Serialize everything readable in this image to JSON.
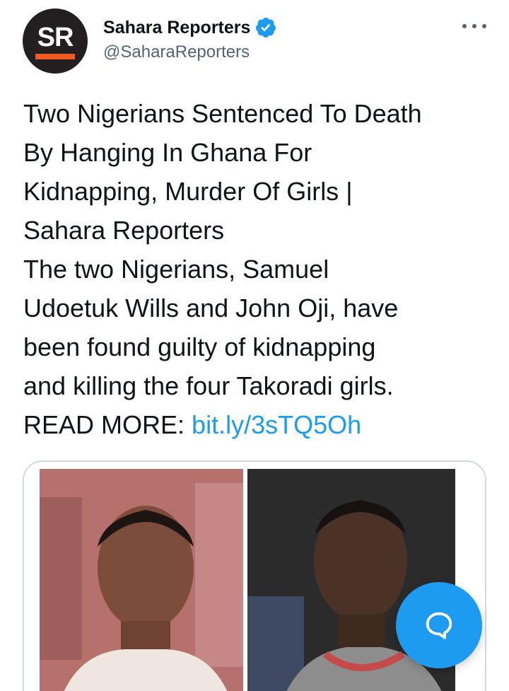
{
  "tweet": {
    "author": {
      "avatar_text": "SR",
      "display_name": "Sahara Reporters",
      "handle": "@SaharaReporters",
      "verified": true
    },
    "body_lines": [
      "Two Nigerians Sentenced To Death",
      "By Hanging In Ghana For",
      "Kidnapping, Murder Of Girls |",
      "Sahara Reporters",
      "The two Nigerians, Samuel",
      "Udoetuk Wills and John Oji, have",
      "been found guilty of kidnapping",
      "and killing the four Takoradi girls."
    ],
    "read_more_label": "READ MORE:",
    "link_text": "bit.ly/3sTQ5Oh"
  },
  "icons": {
    "verified": "verified-badge-icon",
    "more": "more-horizontal-icon",
    "compose": "compose-reply-icon"
  },
  "colors": {
    "accent": "#1d9bf0",
    "brand_bar": "#ef5a24",
    "avatar_bg": "#231f20",
    "secondary_text": "#536471"
  }
}
